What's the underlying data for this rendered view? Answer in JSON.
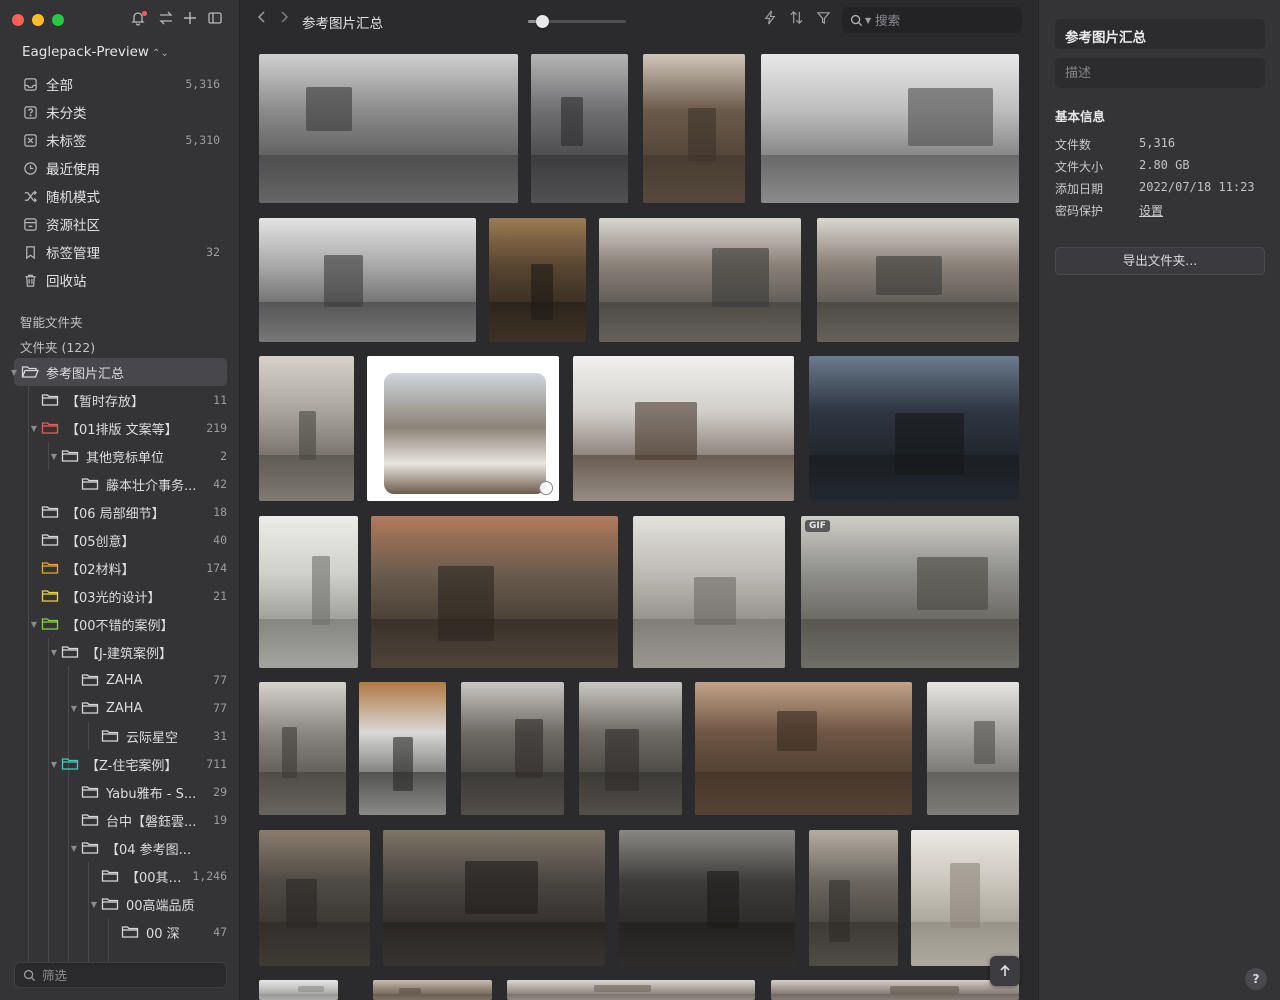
{
  "window": {
    "library_name": "Eaglepack-Preview"
  },
  "nav": {
    "items": [
      {
        "name": "nav-all",
        "icon": "inbox-icon",
        "label": "全部",
        "count": "5,316"
      },
      {
        "name": "nav-uncategorized",
        "icon": "question-box-icon",
        "label": "未分类",
        "count": ""
      },
      {
        "name": "nav-untagged",
        "icon": "untagged-icon",
        "label": "未标签",
        "count": "5,310"
      },
      {
        "name": "nav-recent",
        "icon": "clock-icon",
        "label": "最近使用",
        "count": ""
      },
      {
        "name": "nav-random",
        "icon": "shuffle-icon",
        "label": "随机模式",
        "count": ""
      },
      {
        "name": "nav-community",
        "icon": "community-icon",
        "label": "资源社区",
        "count": ""
      },
      {
        "name": "nav-tags",
        "icon": "bookmark-icon",
        "label": "标签管理",
        "count": "32"
      },
      {
        "name": "nav-trash",
        "icon": "trash-icon",
        "label": "回收站",
        "count": ""
      }
    ],
    "smart_folders_title": "智能文件夹",
    "folders_title": "文件夹 (122)"
  },
  "tree": [
    {
      "label": "参考图片汇总",
      "count": "",
      "depth": 0,
      "twisty": "open",
      "color": "#d6d6da",
      "selected": true
    },
    {
      "label": "【暂时存放】",
      "count": "11",
      "depth": 1,
      "twisty": "",
      "color": "#d6d6da"
    },
    {
      "label": "【01排版 文案等】",
      "count": "219",
      "depth": 1,
      "twisty": "open",
      "color": "#e0605a"
    },
    {
      "label": "其他竞标单位",
      "count": "2",
      "depth": 2,
      "twisty": "open",
      "color": "#d6d6da"
    },
    {
      "label": "藤本壮介事务...",
      "count": "42",
      "depth": 3,
      "twisty": "",
      "color": "#d6d6da"
    },
    {
      "label": "【06 局部细节】",
      "count": "18",
      "depth": 1,
      "twisty": "",
      "color": "#d6d6da"
    },
    {
      "label": "【05创意】",
      "count": "40",
      "depth": 1,
      "twisty": "",
      "color": "#d6d6da"
    },
    {
      "label": "【02材料】",
      "count": "174",
      "depth": 1,
      "twisty": "",
      "color": "#e8a33c"
    },
    {
      "label": "【03光的设计】",
      "count": "21",
      "depth": 1,
      "twisty": "",
      "color": "#e8d43c"
    },
    {
      "label": "【00不错的案例】",
      "count": "",
      "depth": 1,
      "twisty": "open",
      "color": "#7ed348"
    },
    {
      "label": "【J-建筑案例】",
      "count": "",
      "depth": 2,
      "twisty": "open",
      "color": "#d6d6da"
    },
    {
      "label": "ZAHA",
      "count": "77",
      "depth": 3,
      "twisty": "",
      "color": "#d6d6da"
    },
    {
      "label": "ZAHA",
      "count": "77",
      "depth": 3,
      "twisty": "open",
      "color": "#d6d6da"
    },
    {
      "label": "云际星空",
      "count": "31",
      "depth": 4,
      "twisty": "",
      "color": "#d6d6da"
    },
    {
      "label": "【Z-住宅案例】",
      "count": "711",
      "depth": 2,
      "twisty": "open",
      "color": "#3fcfc0"
    },
    {
      "label": "Yabu雅布 - S...",
      "count": "29",
      "depth": 3,
      "twisty": "",
      "color": "#d6d6da"
    },
    {
      "label": "台中【磐鈺雲...",
      "count": "19",
      "depth": 3,
      "twisty": "",
      "color": "#d6d6da"
    },
    {
      "label": "【04 参考图...",
      "count": "",
      "depth": 3,
      "twisty": "open",
      "color": "#d6d6da"
    },
    {
      "label": "【00其他...",
      "count": "1,246",
      "depth": 4,
      "twisty": "",
      "color": "#d6d6da"
    },
    {
      "label": "00高端品质",
      "count": "",
      "depth": 4,
      "twisty": "open",
      "color": "#d6d6da"
    },
    {
      "label": "00 深",
      "count": "47",
      "depth": 5,
      "twisty": "",
      "color": "#d6d6da"
    }
  ],
  "filter": {
    "placeholder": "筛选"
  },
  "toolbar": {
    "folder_title": "参考图片汇总",
    "zoom_level": 0.14,
    "search_placeholder": "搜索"
  },
  "grid": {
    "gif_badge": "GIF"
  },
  "inspector": {
    "title": "参考图片汇总",
    "description_placeholder": "描述",
    "section_title": "基本信息",
    "rows": [
      {
        "key": "文件数",
        "value": "5,316"
      },
      {
        "key": "文件大小",
        "value": "2.80 GB"
      },
      {
        "key": "添加日期",
        "value": "2022/07/18 11:23"
      },
      {
        "key": "密码保护",
        "value": "设置"
      }
    ],
    "export_label": "导出文件夹...",
    "help_label": "?"
  },
  "colors": {
    "sidebar_bg": "#343437",
    "main_bg": "#2b2b2e",
    "selection": "#48484c"
  }
}
